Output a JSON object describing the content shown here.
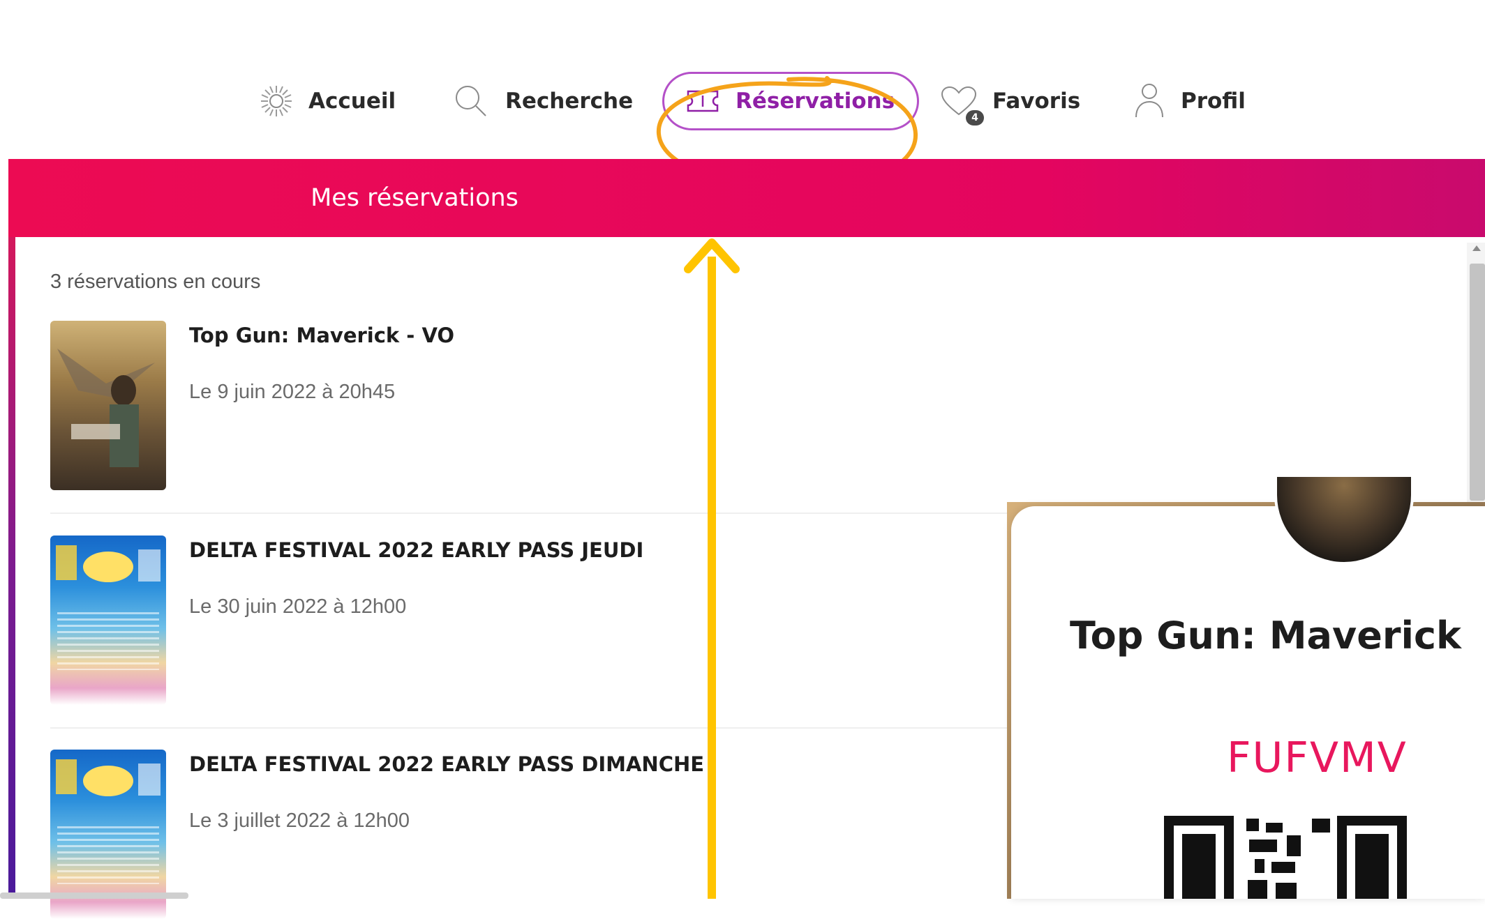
{
  "nav": {
    "items": [
      {
        "key": "accueil",
        "label": "Accueil",
        "icon": "sun-icon"
      },
      {
        "key": "recherche",
        "label": "Recherche",
        "icon": "search-icon"
      },
      {
        "key": "reservations",
        "label": "Réservations",
        "icon": "ticket-icon",
        "active": true
      },
      {
        "key": "favoris",
        "label": "Favoris",
        "icon": "heart-icon",
        "badge": "4"
      },
      {
        "key": "profil",
        "label": "Profil",
        "icon": "user-icon"
      }
    ]
  },
  "banner": {
    "title": "Mes réservations"
  },
  "list": {
    "count_text": "3 réservations en cours",
    "items": [
      {
        "title": "Top Gun: Maverick - VO",
        "date": "Le 9 juin 2022 à 20h45",
        "poster": "topgun"
      },
      {
        "title": "DELTA FESTIVAL 2022 EARLY PASS JEUDI",
        "date": "Le 30 juin 2022 à 12h00",
        "poster": "delta"
      },
      {
        "title": "DELTA FESTIVAL 2022 EARLY PASS DIMANCHE",
        "date": "Le 3 juillet 2022 à 12h00",
        "poster": "delta"
      }
    ]
  },
  "ticket": {
    "title": "Top Gun: Maverick",
    "code": "FUFVMV"
  },
  "colors": {
    "banner": "#ec0b53",
    "active_nav": "#8f1fa6",
    "highlight_circle": "#f5a31a",
    "arrow": "#ffc400",
    "ticket_code": "#e8175d"
  }
}
